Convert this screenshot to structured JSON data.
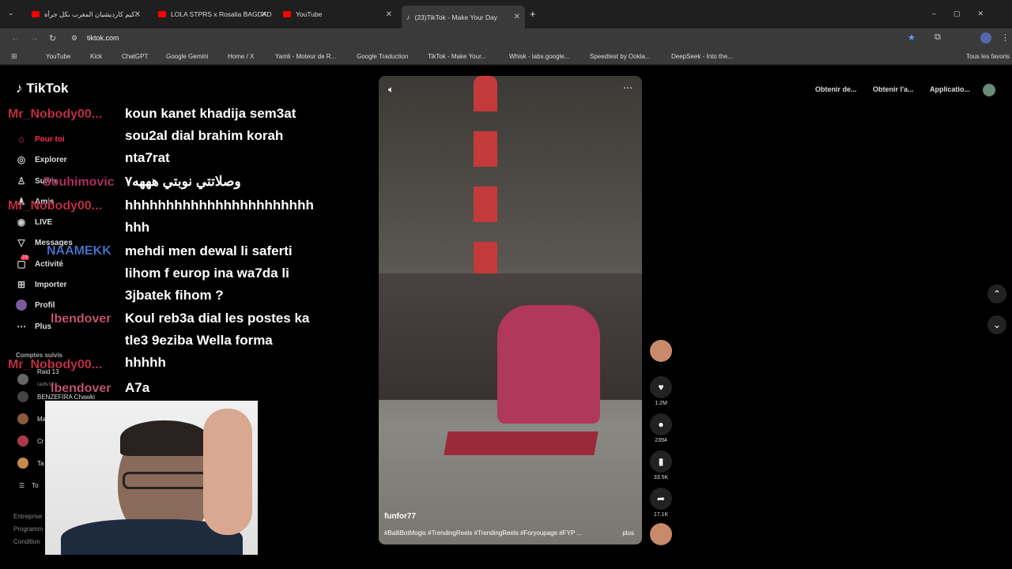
{
  "tabs": [
    {
      "title": "كيم كارديشيان المغرب بكل جرأة…",
      "active": false
    },
    {
      "title": "LOLA STPRS x Rosalia BAGDAD",
      "active": false
    },
    {
      "title": "YouTube",
      "active": false
    },
    {
      "title": "(23)TikTok - Make Your Day",
      "active": true
    }
  ],
  "address": "tiktok.com",
  "bookmarks": [
    "YouTube",
    "Kick",
    "ChatGPT",
    "Google Gemini",
    "Home / X",
    "Yamli - Moteur de R...",
    "Google Traduction",
    "TikTok - Make Your...",
    "Whisk - labs.google...",
    "Speedtest by Ookla...",
    "DeepSeek - Into the...",
    "Tous les favoris"
  ],
  "logo": "TikTok",
  "sidebar": {
    "items": [
      "Pour toi",
      "Explorer",
      "Suivis",
      "Amis",
      "LIVE",
      "Messages",
      "Activité",
      "Importer",
      "Profil",
      "Plus"
    ],
    "following_title": "Comptes suivis",
    "following": [
      {
        "name": "Raid 13",
        "handle": "raidtv13"
      },
      {
        "name": "BENZEFIRA Chawki"
      },
      {
        "name": "Ma"
      },
      {
        "name": "Cr"
      },
      {
        "name": "Ta"
      }
    ],
    "more": "To",
    "footer": [
      "Entreprise",
      "Programm",
      "Condition"
    ],
    "activity_badge": "23"
  },
  "chat": [
    {
      "user": "Mr_Nobody00...",
      "color": "#d4304a",
      "msg": "koun kanet khadija sem3at sou2al dial brahim korah nta7rat"
    },
    {
      "user": "Souhimovic",
      "color": "#c0306a",
      "msg": "وصلاتتي نوبتي هههه٧"
    },
    {
      "user": "Mr_Nobody00...",
      "color": "#d4304a",
      "msg": "hhhhhhhhhhhhhhhhhhhhhhh hhh"
    },
    {
      "user": "NAAMEKK",
      "color": "#4a7ad8",
      "msg": "mehdi men dewal li saferti lihom f europ ina wa7da li 3jbatek fihom ?"
    },
    {
      "user": "lbendover",
      "color": "#d85a7a",
      "msg": "Koul reb3a dial les postes ka tle3 9eziba Wella forma hhhhh"
    },
    {
      "user": "Mr_Nobody00...",
      "color": "#d4304a",
      "msg": ""
    },
    {
      "user": "lbendover",
      "color": "#d85a7a",
      "msg": "A7a"
    }
  ],
  "video": {
    "author": "funfor77",
    "caption": "#BalliBotMogis #TrendingReels #TrendingReels #Foryoupage #FYP ...",
    "more": "plus"
  },
  "actions": {
    "likes": "1.2M",
    "comments": "2394",
    "saves": "33.5K",
    "shares": "17.1K"
  },
  "topbar": [
    "Obtenir de...",
    "Obtenir l'a...",
    "Applicatio..."
  ]
}
